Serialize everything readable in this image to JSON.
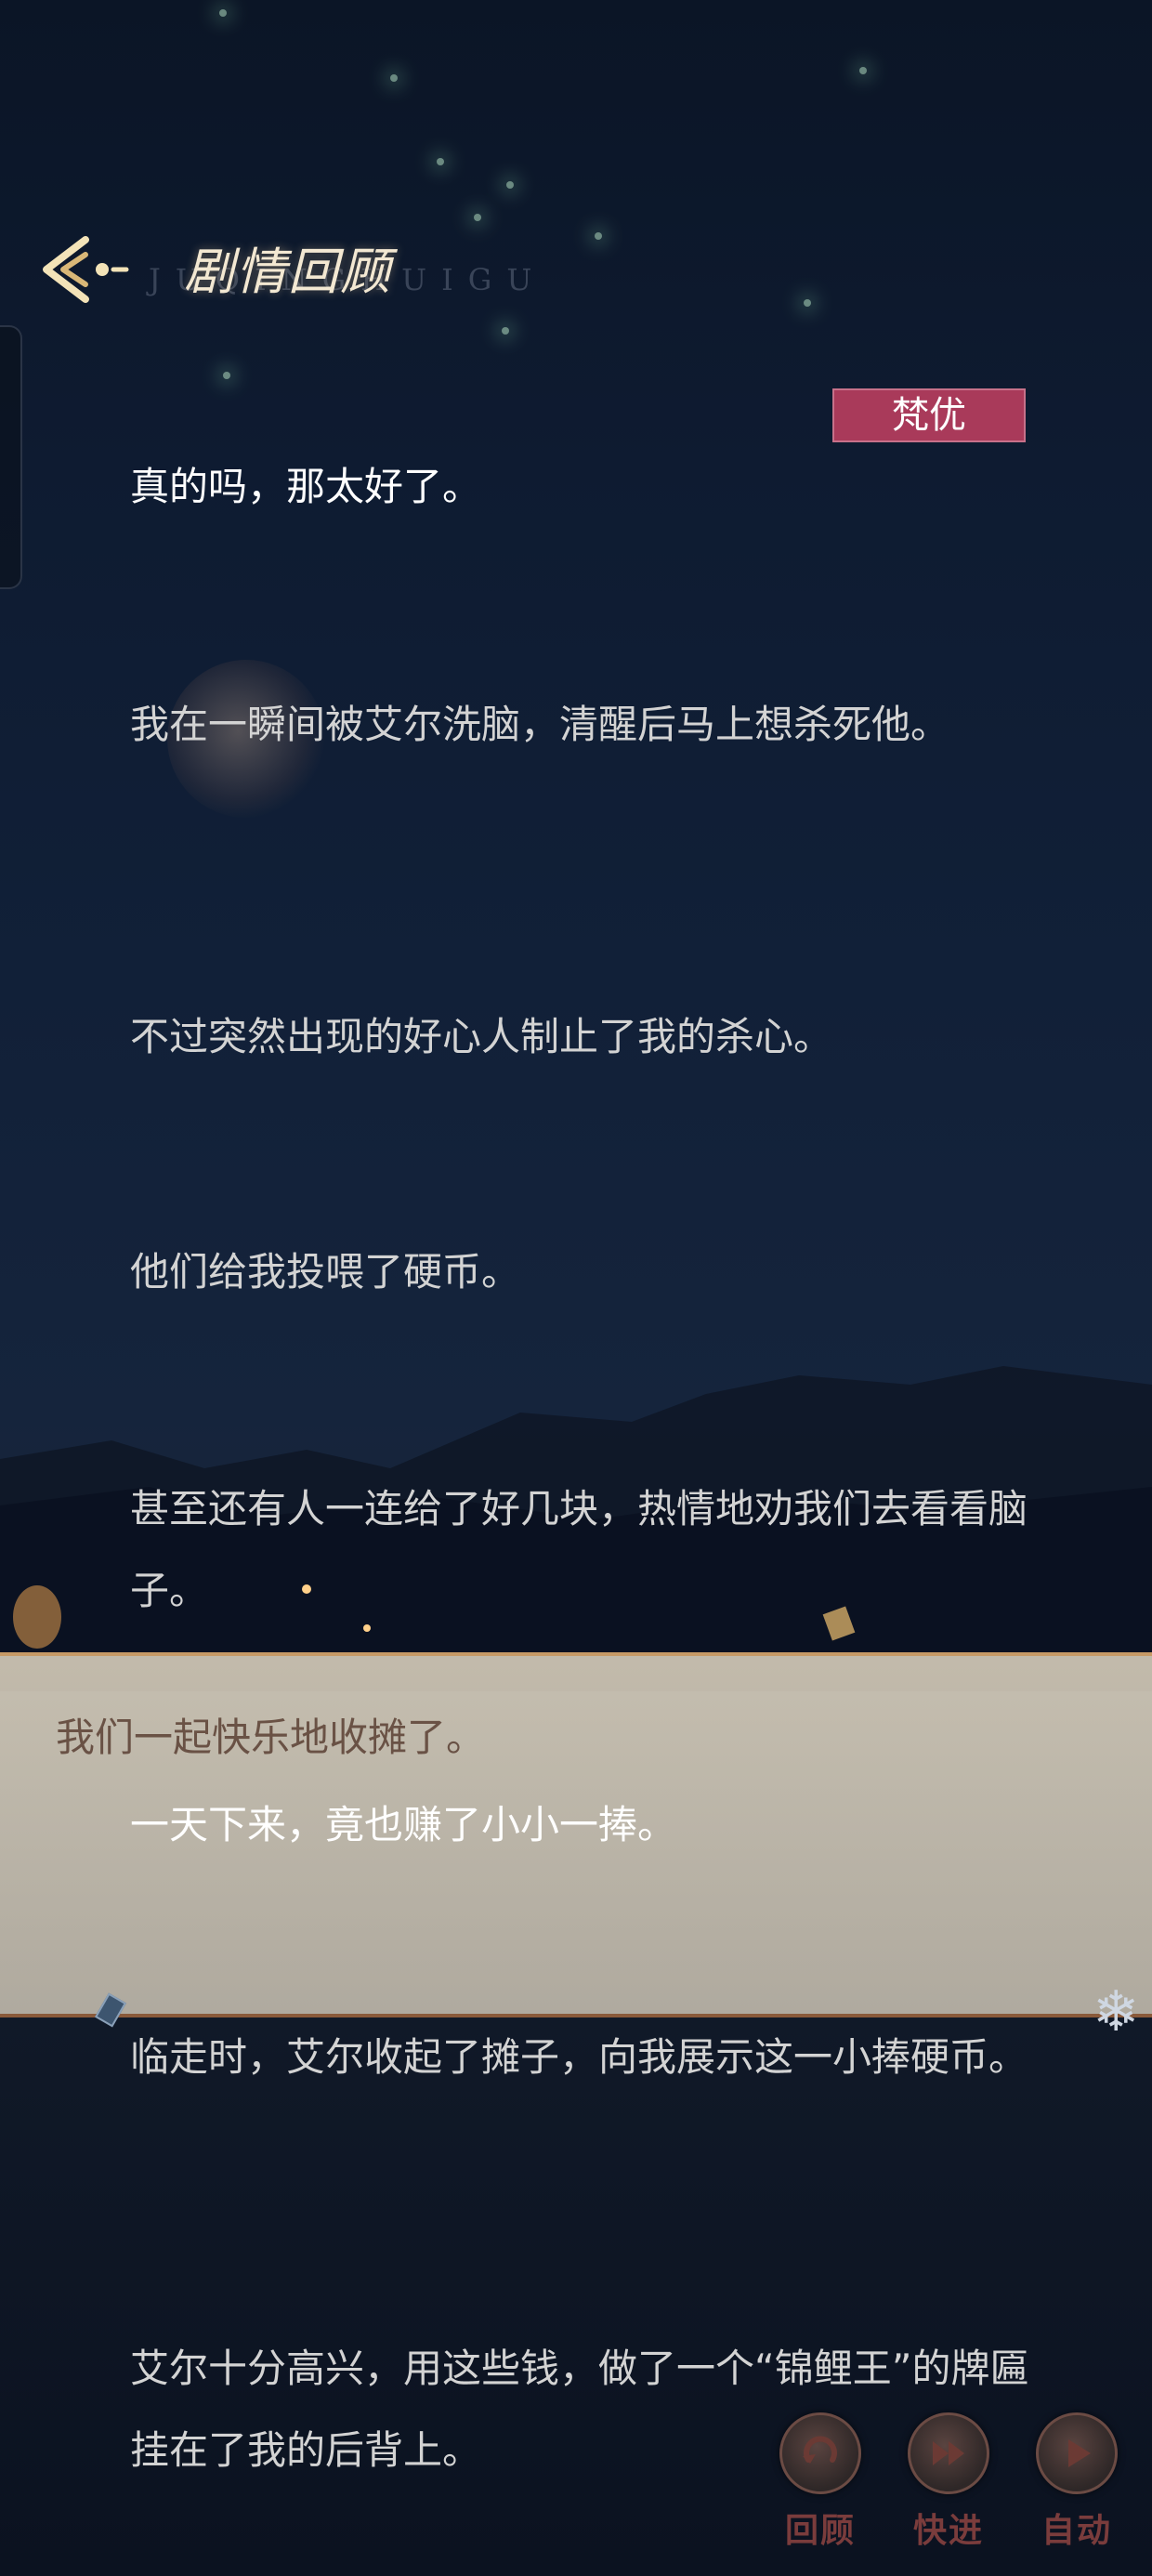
{
  "header": {
    "title": "剧情回顾",
    "subtitle": "JUQINGHUIGU"
  },
  "entries": [
    {
      "speaker": "梵优",
      "text": "真的吗，那太好了。"
    },
    {
      "text": "我在一瞬间被艾尔洗脑，清醒后马上想杀死他。"
    },
    {
      "text": "不过突然出现的好心人制止了我的杀心。"
    },
    {
      "text": "他们给我投喂了硬币。"
    },
    {
      "text": "甚至还有人一连给了好几块，热情地劝我们去看看脑子。"
    },
    {
      "text": "我们一起快乐地收摊了。"
    },
    {
      "text": "一天下来，竟也赚了小小一捧。"
    },
    {
      "text": "临走时，艾尔收起了摊子，向我展示这一小捧硬币。"
    },
    {
      "text": "艾尔十分高兴，用这些钱，做了一个“锦鲤王”的牌匾挂在了我的后背上。"
    }
  ],
  "controls": [
    {
      "label": "回顾",
      "icon": "replay-icon"
    },
    {
      "label": "快进",
      "icon": "fast-forward-icon"
    },
    {
      "label": "自动",
      "icon": "play-icon"
    }
  ],
  "colors": {
    "speaker_tag": "#a93a5a",
    "control_label": "#7a3c3c",
    "panel": "#f3e6cc"
  }
}
